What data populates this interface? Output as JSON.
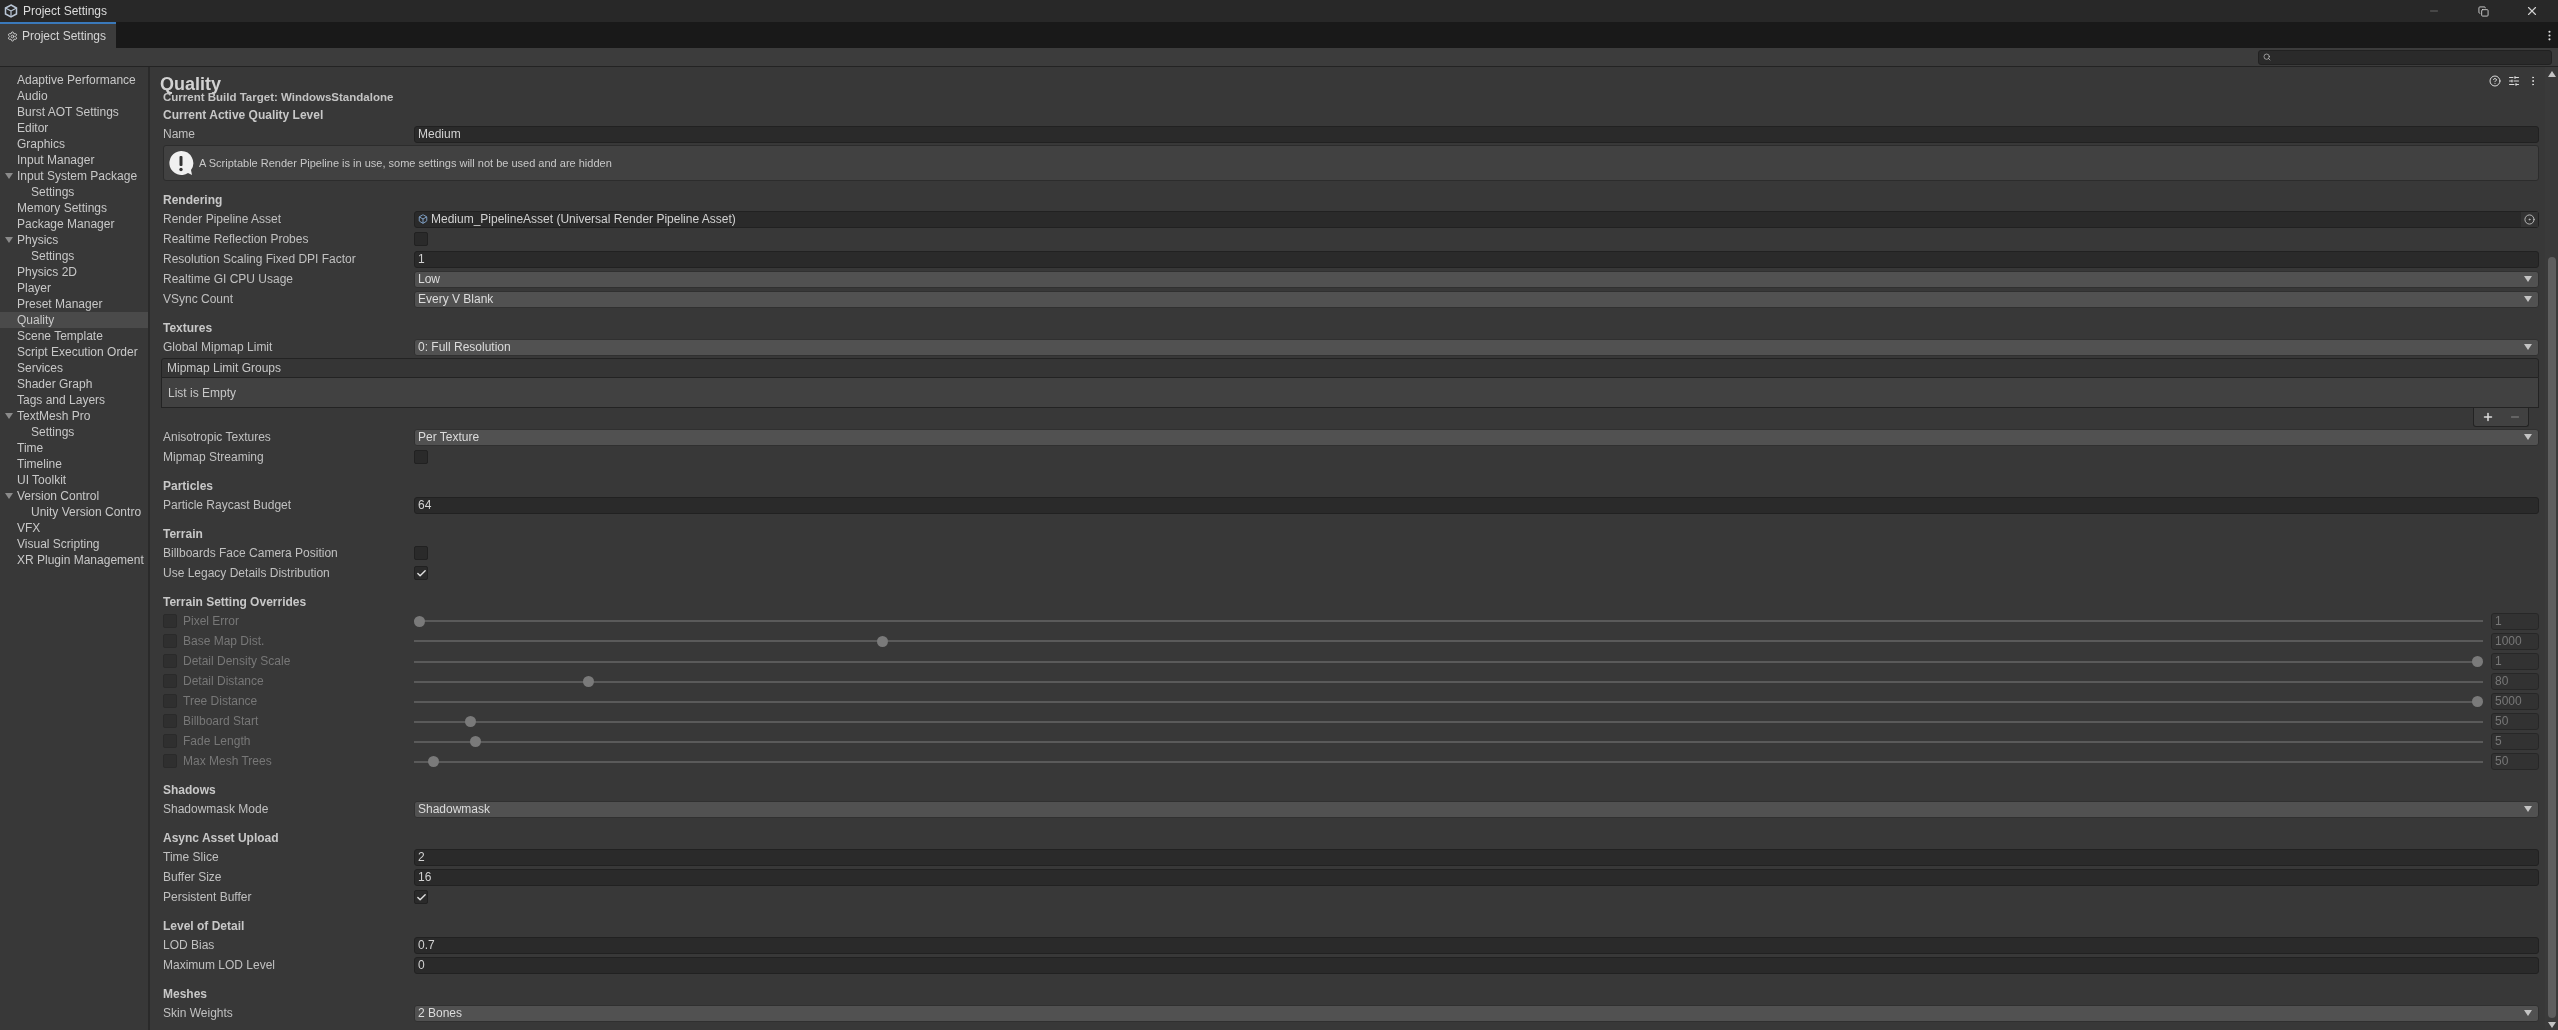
{
  "window": {
    "title": "Project Settings"
  },
  "tabs": [
    {
      "label": "Project Settings",
      "selected": true
    }
  ],
  "sidebar": {
    "items": [
      {
        "label": "Adaptive Performance",
        "selected": false
      },
      {
        "label": "Audio",
        "selected": false
      },
      {
        "label": "Burst AOT Settings",
        "selected": false
      },
      {
        "label": "Editor",
        "selected": false
      },
      {
        "label": "Graphics",
        "selected": false
      },
      {
        "label": "Input Manager",
        "selected": false
      },
      {
        "label": "Input System Package",
        "selected": false,
        "expanded": true,
        "children": [
          {
            "label": "Settings",
            "selected": false
          }
        ]
      },
      {
        "label": "Memory Settings",
        "selected": false
      },
      {
        "label": "Package Manager",
        "selected": false
      },
      {
        "label": "Physics",
        "selected": false,
        "expanded": true,
        "children": [
          {
            "label": "Settings",
            "selected": false
          }
        ]
      },
      {
        "label": "Physics 2D",
        "selected": false
      },
      {
        "label": "Player",
        "selected": false
      },
      {
        "label": "Preset Manager",
        "selected": false
      },
      {
        "label": "Quality",
        "selected": true
      },
      {
        "label": "Scene Template",
        "selected": false
      },
      {
        "label": "Script Execution Order",
        "selected": false
      },
      {
        "label": "Services",
        "selected": false
      },
      {
        "label": "Shader Graph",
        "selected": false
      },
      {
        "label": "Tags and Layers",
        "selected": false
      },
      {
        "label": "TextMesh Pro",
        "selected": false,
        "expanded": true,
        "children": [
          {
            "label": "Settings",
            "selected": false
          }
        ]
      },
      {
        "label": "Time",
        "selected": false
      },
      {
        "label": "Timeline",
        "selected": false
      },
      {
        "label": "UI Toolkit",
        "selected": false
      },
      {
        "label": "Version Control",
        "selected": false,
        "expanded": true,
        "children": [
          {
            "label": "Unity Version Contro",
            "selected": false
          }
        ]
      },
      {
        "label": "VFX",
        "selected": false
      },
      {
        "label": "Visual Scripting",
        "selected": false
      },
      {
        "label": "XR Plugin Management",
        "selected": false
      }
    ]
  },
  "page": {
    "title": "Quality",
    "build_target": "Current Build Target: WindowsStandalone"
  },
  "sections": [
    {
      "heading": "Current Active Quality Level",
      "rows": [
        {
          "kind": "text",
          "label": "Name",
          "value": "Medium"
        },
        {
          "kind": "warning",
          "text": "A Scriptable Render Pipeline is in use, some settings will not be used and are hidden"
        }
      ]
    },
    {
      "heading": "Rendering",
      "rows": [
        {
          "kind": "object",
          "label": "Render Pipeline Asset",
          "value": "Medium_PipelineAsset (Universal Render Pipeline Asset)"
        },
        {
          "kind": "checkbox",
          "label": "Realtime Reflection Probes",
          "checked": false
        },
        {
          "kind": "text",
          "label": "Resolution Scaling Fixed DPI Factor",
          "value": "1"
        },
        {
          "kind": "dropdown",
          "label": "Realtime GI CPU Usage",
          "value": "Low"
        },
        {
          "kind": "dropdown",
          "label": "VSync Count",
          "value": "Every V Blank"
        }
      ]
    },
    {
      "heading": "Textures",
      "rows": [
        {
          "kind": "dropdown",
          "label": "Global Mipmap Limit",
          "value": "0: Full Resolution"
        },
        {
          "kind": "list",
          "title": "Mipmap Limit Groups",
          "empty_text": "List is Empty"
        },
        {
          "kind": "dropdown",
          "label": "Anisotropic Textures",
          "value": "Per Texture"
        },
        {
          "kind": "checkbox",
          "label": "Mipmap Streaming",
          "checked": false
        }
      ]
    },
    {
      "heading": "Particles",
      "rows": [
        {
          "kind": "text",
          "label": "Particle Raycast Budget",
          "value": "64"
        }
      ]
    },
    {
      "heading": "Terrain",
      "rows": [
        {
          "kind": "checkbox",
          "label": "Billboards Face Camera Position",
          "checked": false
        },
        {
          "kind": "checkbox",
          "label": "Use Legacy Details Distribution",
          "checked": true
        }
      ]
    },
    {
      "heading": "Terrain Setting Overrides",
      "rows": [
        {
          "kind": "override",
          "label": "Pixel Error",
          "checked": false,
          "disabled": true,
          "level": 0.0,
          "value": "1"
        },
        {
          "kind": "override",
          "label": "Base Map Dist.",
          "checked": false,
          "disabled": true,
          "level": 0.225,
          "value": "1000"
        },
        {
          "kind": "override",
          "label": "Detail Density Scale",
          "checked": false,
          "disabled": true,
          "level": 1.0,
          "value": "1"
        },
        {
          "kind": "override",
          "label": "Detail Distance",
          "checked": false,
          "disabled": true,
          "level": 0.082,
          "value": "80"
        },
        {
          "kind": "override",
          "label": "Tree Distance",
          "checked": false,
          "disabled": true,
          "level": 1.0,
          "value": "5000"
        },
        {
          "kind": "override",
          "label": "Billboard Start",
          "checked": false,
          "disabled": true,
          "level": 0.025,
          "value": "50"
        },
        {
          "kind": "override",
          "label": "Fade Length",
          "checked": false,
          "disabled": true,
          "level": 0.027,
          "value": "5"
        },
        {
          "kind": "override",
          "label": "Max Mesh Trees",
          "checked": false,
          "disabled": true,
          "level": 0.007,
          "value": "50"
        }
      ]
    },
    {
      "heading": "Shadows",
      "rows": [
        {
          "kind": "dropdown",
          "label": "Shadowmask Mode",
          "value": "Shadowmask"
        }
      ]
    },
    {
      "heading": "Async Asset Upload",
      "rows": [
        {
          "kind": "text",
          "label": "Time Slice",
          "value": "2"
        },
        {
          "kind": "text",
          "label": "Buffer Size",
          "value": "16"
        },
        {
          "kind": "checkbox",
          "label": "Persistent Buffer",
          "checked": true
        }
      ]
    },
    {
      "heading": "Level of Detail",
      "rows": [
        {
          "kind": "text",
          "label": "LOD Bias",
          "value": "0.7"
        },
        {
          "kind": "text",
          "label": "Maximum LOD Level",
          "value": "0"
        }
      ]
    },
    {
      "heading": "Meshes",
      "rows": [
        {
          "kind": "dropdown",
          "label": "Skin Weights",
          "value": "2 Bones"
        }
      ]
    }
  ]
}
